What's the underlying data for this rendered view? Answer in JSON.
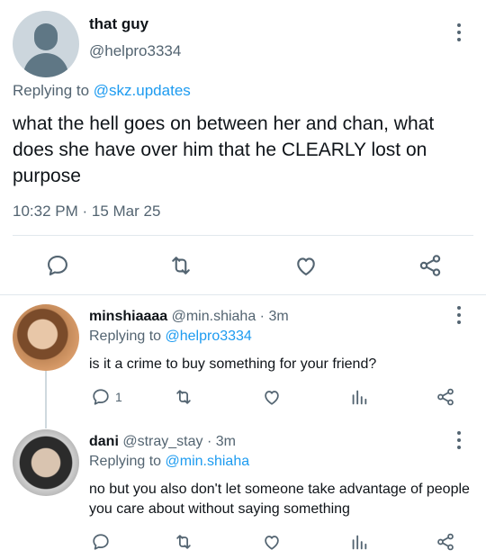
{
  "main_tweet": {
    "display_name": "that guy",
    "handle": "@helpro3334",
    "replying_prefix": "Replying to",
    "replying_to": "@skz.updates",
    "text": "what the hell goes on between her and chan, what does she have over him that he CLEARLY lost on purpose",
    "timestamp": "10:32 PM · 15 Mar 25"
  },
  "replies": [
    {
      "name": "minshiaaaa",
      "handle_time": "@min.shiaha · 3m",
      "replying_prefix": "Replying to",
      "replying_to": "@helpro3334",
      "text": "is it a crime to buy something for your friend?",
      "reply_count": "1"
    },
    {
      "name": "dani",
      "handle_time": "@stray_stay · 3m",
      "replying_prefix": "Replying to",
      "replying_to": "@min.shiaha",
      "text": "no but you also don't let someone take advantage of people you care about without saying something",
      "reply_count": ""
    }
  ],
  "icons": {
    "reply": "speech-bubble-icon",
    "retweet": "retweet-icon",
    "like": "heart-icon",
    "views": "bar-chart-icon",
    "share": "share-icon",
    "menu": "more-vertical-icon"
  },
  "colors": {
    "link": "#1d9bf0",
    "secondary_text": "#536471",
    "primary_text": "#0f1419",
    "divider": "#e1e8ed"
  }
}
